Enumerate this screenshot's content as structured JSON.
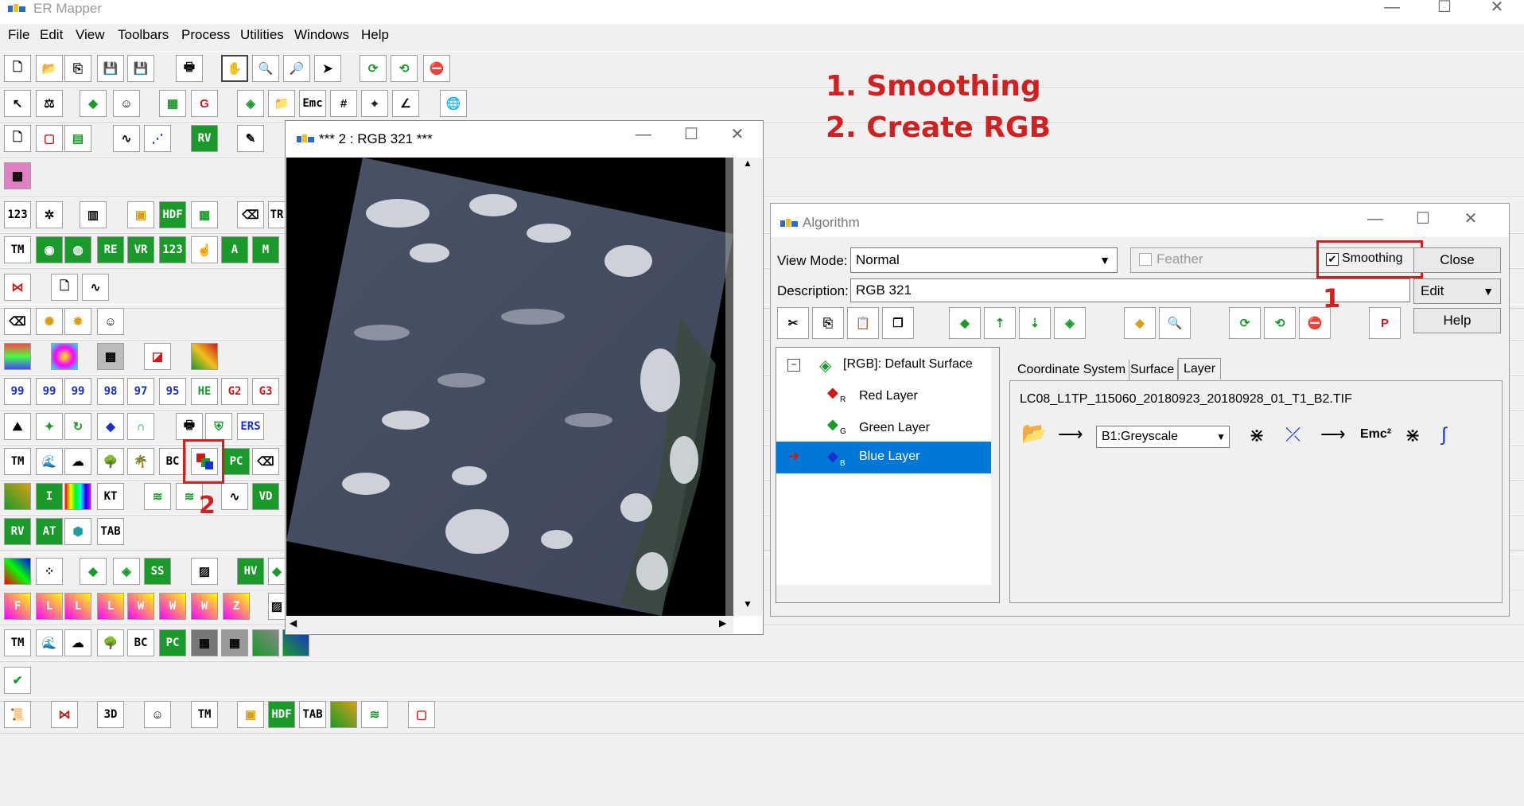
{
  "app": {
    "title": "ER Mapper"
  },
  "menu": [
    "File",
    "Edit",
    "View",
    "Toolbars",
    "Process",
    "Utilities",
    "Windows",
    "Help"
  ],
  "annotations": {
    "line1": "1. Smoothing",
    "line2": "2. Create RGB",
    "marker1": "1",
    "marker2": "2"
  },
  "toolbar_text_icons": {
    "rv": "RV",
    "tm": "TM",
    "re": "RE",
    "vr": "VR",
    "a": "A",
    "m": "M",
    "hdf": "HDF",
    "tr": "TR",
    "n99": "99",
    "n98": "98",
    "n97": "97",
    "n95": "95",
    "he": "HE",
    "g2": "G2",
    "g3": "G3",
    "ers": "ERS",
    "pc": "PC",
    "i": "I",
    "vd": "VD",
    "at": "AT",
    "tab": "TAB",
    "ss": "SS",
    "hv": "HV",
    "f": "F",
    "l": "L",
    "w": "W",
    "z": "Z",
    "d3": "3D",
    "emc": "Emc"
  },
  "image_window": {
    "title": "*** 2 : RGB 321 ***"
  },
  "algorithm": {
    "title": "Algorithm",
    "view_mode_label": "View Mode:",
    "view_mode_value": "Normal",
    "feather_label": "Feather",
    "smoothing_label": "Smoothing",
    "smoothing_checked": true,
    "close_label": "Close",
    "edit_label": "Edit",
    "help_label": "Help",
    "description_label": "Description:",
    "description_value": "RGB 321",
    "tree": {
      "root": "[RGB]: Default Surface",
      "layers": [
        {
          "label": "Red Layer",
          "sub": "R",
          "color": "#d01818"
        },
        {
          "label": "Green Layer",
          "sub": "G",
          "color": "#1a9a2a"
        },
        {
          "label": "Blue Layer",
          "sub": "B",
          "color": "#1830d0"
        }
      ],
      "selected_index": 2
    },
    "tabs": [
      "Coordinate System",
      "Surface",
      "Layer"
    ],
    "active_tab": "Layer",
    "layer_file": "LC08_L1TP_115060_20180923_20180928_01_T1_B2.TIF",
    "lut_value": "B1:Greyscale",
    "formula_icon": "Emc²"
  },
  "colors": {
    "selection": "#0078d7",
    "annotation": "#d02020"
  }
}
